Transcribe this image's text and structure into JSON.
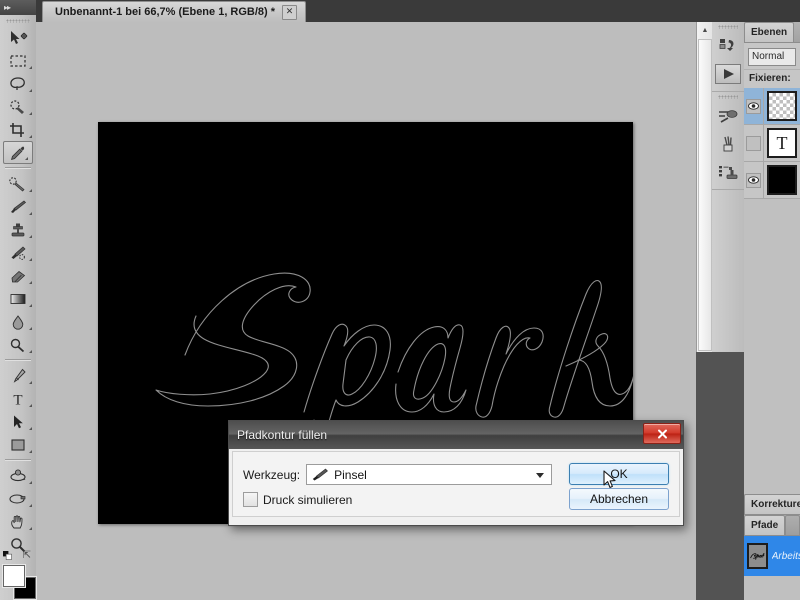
{
  "document_tab": {
    "title": "Unbenannt-1 bei 66,7% (Ebene 1, RGB/8) *",
    "close_label": "✕"
  },
  "canvas": {
    "artwork_text": "Sparkle",
    "background_color": "#000000",
    "path_stroke_color": "#8f8f8f",
    "workspace_color": "#bdbdbd",
    "zoom": "66,7%"
  },
  "toolbar": {
    "expander_label": "▸▸",
    "tools": [
      {
        "name": "move-tool",
        "icon": "move"
      },
      {
        "name": "marquee-tool",
        "icon": "marquee"
      },
      {
        "name": "lasso-tool",
        "icon": "lasso"
      },
      {
        "name": "quick-selection-tool",
        "icon": "quick-select"
      },
      {
        "name": "crop-tool",
        "icon": "crop"
      },
      {
        "name": "eyedropper-tool",
        "icon": "eyedropper"
      },
      {
        "name": "healing-brush-tool",
        "icon": "healing"
      },
      {
        "name": "brush-tool",
        "icon": "brush"
      },
      {
        "name": "clone-stamp-tool",
        "icon": "stamp"
      },
      {
        "name": "history-brush-tool",
        "icon": "history-brush"
      },
      {
        "name": "eraser-tool",
        "icon": "eraser"
      },
      {
        "name": "gradient-tool",
        "icon": "gradient"
      },
      {
        "name": "blur-tool",
        "icon": "blur"
      },
      {
        "name": "dodge-tool",
        "icon": "dodge"
      },
      {
        "name": "pen-tool",
        "icon": "pen"
      },
      {
        "name": "type-tool",
        "icon": "type"
      },
      {
        "name": "path-selection-tool",
        "icon": "path-arrow"
      },
      {
        "name": "shape-tool",
        "icon": "rectangle"
      },
      {
        "name": "rotate-3d-tool",
        "icon": "rotate-3d"
      },
      {
        "name": "orbit-3d-tool",
        "icon": "orbit-3d"
      },
      {
        "name": "hand-tool",
        "icon": "hand"
      },
      {
        "name": "zoom-tool",
        "icon": "magnifier"
      }
    ],
    "active_tool": "eyedropper-tool",
    "foreground_color": "#ffffff",
    "background_color": "#000000"
  },
  "dock": {
    "items": [
      {
        "name": "history-icon",
        "label": "history"
      },
      {
        "name": "play-icon",
        "label": "play"
      },
      {
        "name": "brush-presets-icon",
        "label": "brush-presets"
      },
      {
        "name": "brush-tip-icon",
        "label": "brush-tip"
      },
      {
        "name": "clone-source-icon",
        "label": "clone-source"
      }
    ]
  },
  "layers_panel": {
    "tab_label": "Ebenen",
    "blend_mode": "Normal",
    "lock_label": "Fixieren:",
    "layers": [
      {
        "thumb": "checker",
        "visible": true,
        "selected": true,
        "glyph": ""
      },
      {
        "thumb": "text",
        "visible": false,
        "selected": false,
        "glyph": "T"
      },
      {
        "thumb": "black",
        "visible": true,
        "selected": false,
        "glyph": ""
      }
    ],
    "eye_glyph": "◉"
  },
  "adjustments_panel": {
    "tab_label": "Korrekturen"
  },
  "paths_panel": {
    "tab_label": "Pfade",
    "path_name": "Arbeitspfad",
    "thumb_text": "Sparkle"
  },
  "dialog": {
    "title": "Pfadkontur füllen",
    "close_label": "✕",
    "tool_label": "Werkzeug:",
    "tool_value": "Pinsel",
    "simulate_pressure_label": "Druck simulieren",
    "simulate_pressure_checked": false,
    "ok_label": "OK",
    "cancel_label": "Abbrechen"
  },
  "scrollbar": {
    "up_arrow": "▲"
  }
}
